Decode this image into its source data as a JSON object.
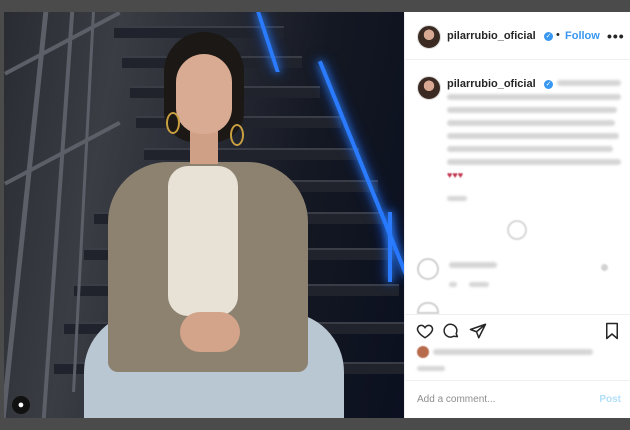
{
  "post": {
    "username": "pilarrubio_oficial",
    "follow_separator": "•",
    "follow_label": "Follow",
    "more_label": "•••",
    "verified_glyph": "✓",
    "hearts": "♥♥♥"
  },
  "comment_box": {
    "placeholder": "Add a comment...",
    "post_label": "Post"
  },
  "icons": {
    "like": "heart-outline-icon",
    "comment": "speech-bubble-icon",
    "share": "paper-plane-icon",
    "save": "bookmark-icon",
    "load_more": "plus-circle-icon",
    "account": "person-icon"
  },
  "colors": {
    "link": "#3897f0",
    "text": "#262626",
    "neon": "#2a7bff"
  }
}
